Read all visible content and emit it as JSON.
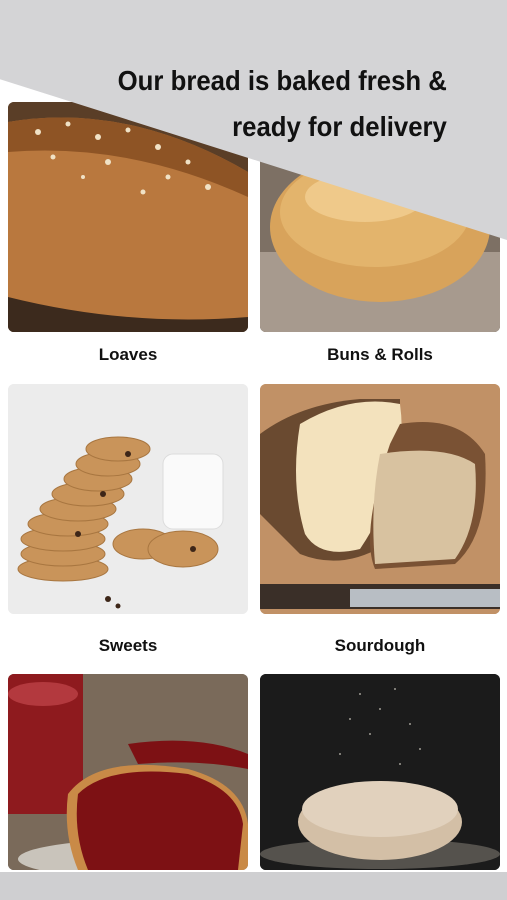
{
  "header": {
    "line1": "Our bread is baked fresh &",
    "line2": "ready for delivery"
  },
  "categories": [
    {
      "label": "Loaves"
    },
    {
      "label": "Buns & Rolls"
    },
    {
      "label": "Sweets"
    },
    {
      "label": "Sourdough"
    }
  ],
  "colors": {
    "banner": "#d4d4d6",
    "text": "#111111"
  }
}
